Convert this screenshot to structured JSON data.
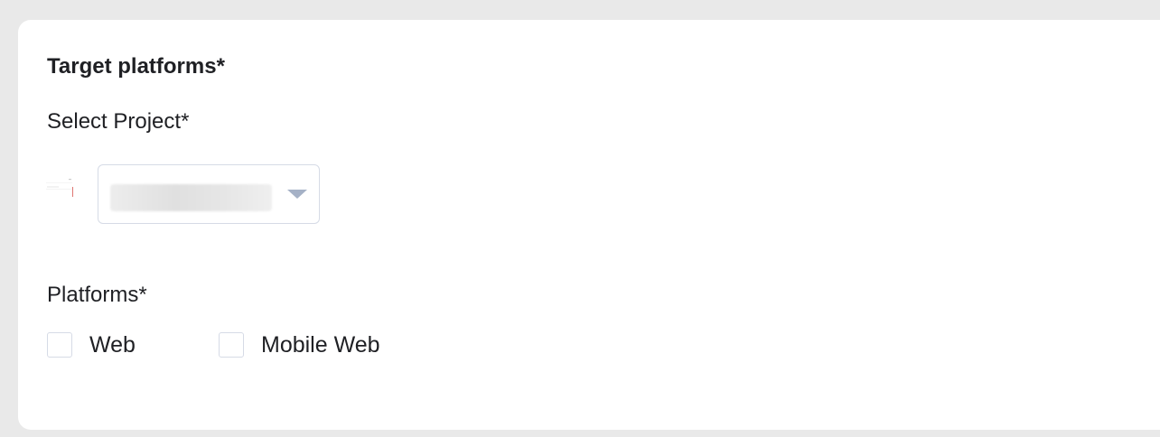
{
  "section": {
    "title": "Target platforms*"
  },
  "project": {
    "label": "Select Project*",
    "selected_value": "",
    "thumbnail_icon": "project-thumbnail-icon",
    "arrow_icon": "dropdown-arrow-icon"
  },
  "platforms": {
    "label": "Platforms*",
    "options": [
      {
        "label": "Web",
        "checked": false
      },
      {
        "label": "Mobile Web",
        "checked": false
      }
    ]
  },
  "colors": {
    "page_background": "#e9e9e9",
    "card_background": "#ffffff",
    "text": "#1f2024",
    "input_border": "#d6dbe6",
    "arrow": "#a5b1c6",
    "thumbnail_accent": "#d9534f"
  }
}
